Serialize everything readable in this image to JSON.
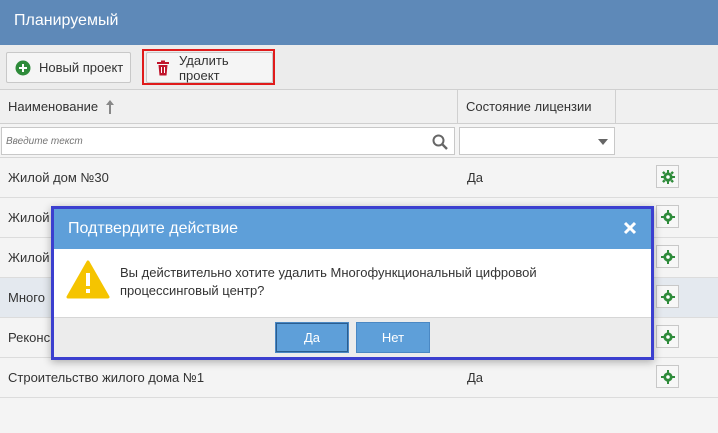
{
  "header": {
    "title": "Планируемый"
  },
  "toolbar": {
    "new_project_label": "Новый проект",
    "delete_project_label": "Удалить проект",
    "colors": {
      "new_icon": "#2e8b3a",
      "delete_icon": "#c0142b",
      "highlight": "#e01b1b"
    }
  },
  "grid": {
    "columns": {
      "name": "Наименование",
      "license": "Состояние лицензии"
    },
    "filter": {
      "placeholder": "Введите текст"
    },
    "rows": [
      {
        "name": "Жилой дом №30",
        "license": "Да"
      },
      {
        "name": "Жилой",
        "license": ""
      },
      {
        "name": "Жилой",
        "license": ""
      },
      {
        "name": "Много",
        "license": ""
      },
      {
        "name": "Реконс",
        "license": ""
      },
      {
        "name": "Строительство жилого дома №1",
        "license": "Да"
      }
    ]
  },
  "dialog": {
    "title": "Подтвердите действие",
    "message": "Вы действительно хотите удалить Многофункциональный цифровой процессинговый центр?",
    "yes_label": "Да",
    "no_label": "Нет",
    "colors": {
      "header": "#5e9fd9",
      "border": "#3b3fcf",
      "warning": "#f5c400"
    }
  }
}
